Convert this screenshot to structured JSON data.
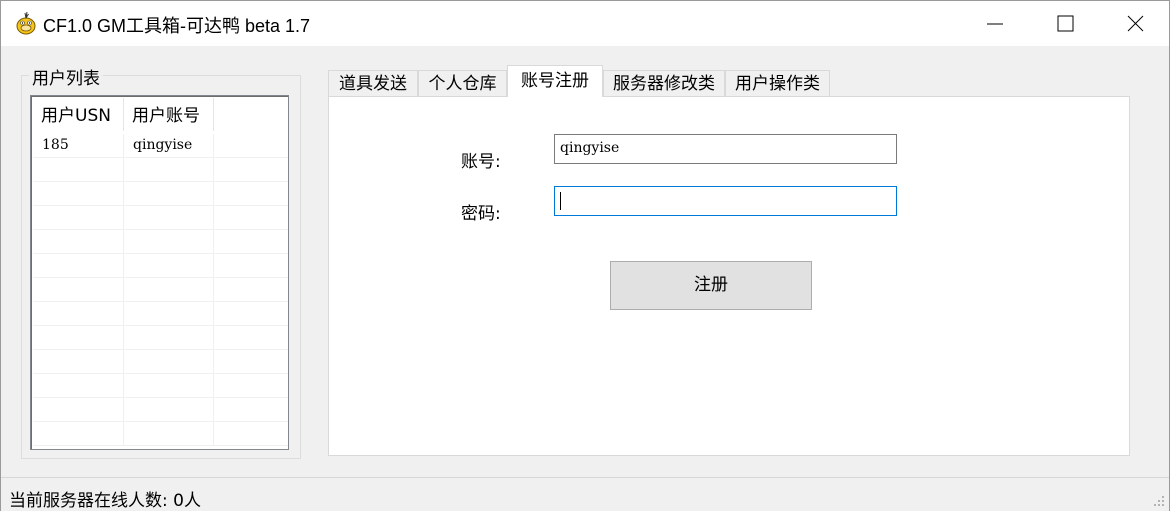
{
  "window": {
    "title": "CF1.0 GM工具箱-可达鸭 beta 1.7",
    "icon": "psyduck-icon",
    "controls": [
      "minimize-icon",
      "maximize-icon",
      "close-icon"
    ]
  },
  "user_list": {
    "group_title": "用户列表",
    "columns": [
      "用户USN",
      "用户账号"
    ],
    "rows": [
      [
        "185",
        "qingyise"
      ]
    ]
  },
  "tabs": [
    {
      "label": "道具发送"
    },
    {
      "label": "个人仓库"
    },
    {
      "label": "账号注册",
      "active": true
    },
    {
      "label": "服务器修改类"
    },
    {
      "label": "用户操作类"
    }
  ],
  "register": {
    "account_label": "账号:",
    "account_value": "qingyise",
    "password_label": "密码:",
    "password_value": "",
    "submit_label": "注册"
  },
  "status": {
    "online_text": "当前服务器在线人数:  0人"
  },
  "colors": {
    "focus_border": "#0078d7",
    "window_bg": "#f0f0f0",
    "button_bg": "#e1e1e1"
  }
}
